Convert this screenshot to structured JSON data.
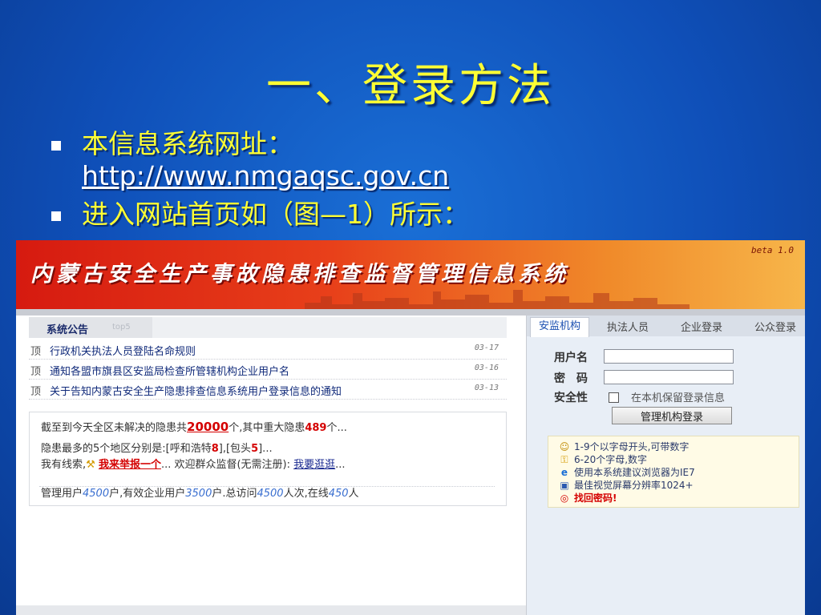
{
  "slide": {
    "title": "一、登录方法",
    "bullet1_label": "本信息系统网址：",
    "bullet1_url": "http://www.nmgaqsc.gov.cn",
    "bullet2_label": "进入网站首页如（图—1）所示："
  },
  "site": {
    "banner_title": "内蒙古安全生产事故隐患排查监督管理信息系统",
    "version": "beta 1.0",
    "colors": {
      "banner_start": "#d61a10",
      "banner_end": "#f7b64a",
      "accent_red": "#d40000",
      "link_blue": "#102a7a"
    }
  },
  "announcements": {
    "tab_label": "系统公告",
    "tab_sub": "top5",
    "pin_label": "顶",
    "items": [
      {
        "text": "行政机关执法人员登陆名命规则",
        "date": "03-17"
      },
      {
        "text": "通知各盟市旗县区安监局检查所管辖机构企业用户名",
        "date": "03-16"
      },
      {
        "text": "关于告知内蒙古安全生产隐患排查信息系统用户登录信息的通知",
        "date": "03-13"
      }
    ]
  },
  "stats": {
    "line1_prefix": "截至到今天全区未解决的隐患共",
    "line1_total": "20000",
    "line1_mid": "个,其中重大隐患",
    "line1_major": "489",
    "line1_suffix": "个...",
    "line2_prefix": "隐患最多的5个地区分别是:[呼和浩特",
    "line2_hhht": "8",
    "line2_mid": "],[包头",
    "line2_bt": "5",
    "line2_suffix": "]...",
    "line3_prefix": "我有线索,",
    "line3_report": "我来举报一个",
    "line3_mid": "... 欢迎群众监督(无需注册):",
    "line3_visit": "我要逛逛",
    "line3_suffix": "...",
    "line4_a": "管理用户",
    "line4_admins": "4500",
    "line4_b": "户,有效企业用户",
    "line4_ent": "3500",
    "line4_c": "户.总访问",
    "line4_visits": "4500",
    "line4_d": "人次,在线",
    "line4_online": "450",
    "line4_e": "人"
  },
  "login": {
    "tabs": [
      "安监机构",
      "执法人员",
      "企业登录",
      "公众登录"
    ],
    "username_label": "用户名",
    "password_label": "密　码",
    "security_label": "安全性",
    "remember_label": "在本机保留登录信息",
    "button_label": "管理机构登录",
    "tips": [
      {
        "icon": "user-icon",
        "text": "1-9个以字母开头,可带数字"
      },
      {
        "icon": "key-icon",
        "text": "6-20个字母,数字"
      },
      {
        "icon": "ie-icon",
        "text": "使用本系统建议浏览器为IE7"
      },
      {
        "icon": "monitor-icon",
        "text": "最佳视觉屏幕分辨率1024+"
      },
      {
        "icon": "lifebuoy-icon",
        "text": "找回密码!"
      }
    ]
  }
}
